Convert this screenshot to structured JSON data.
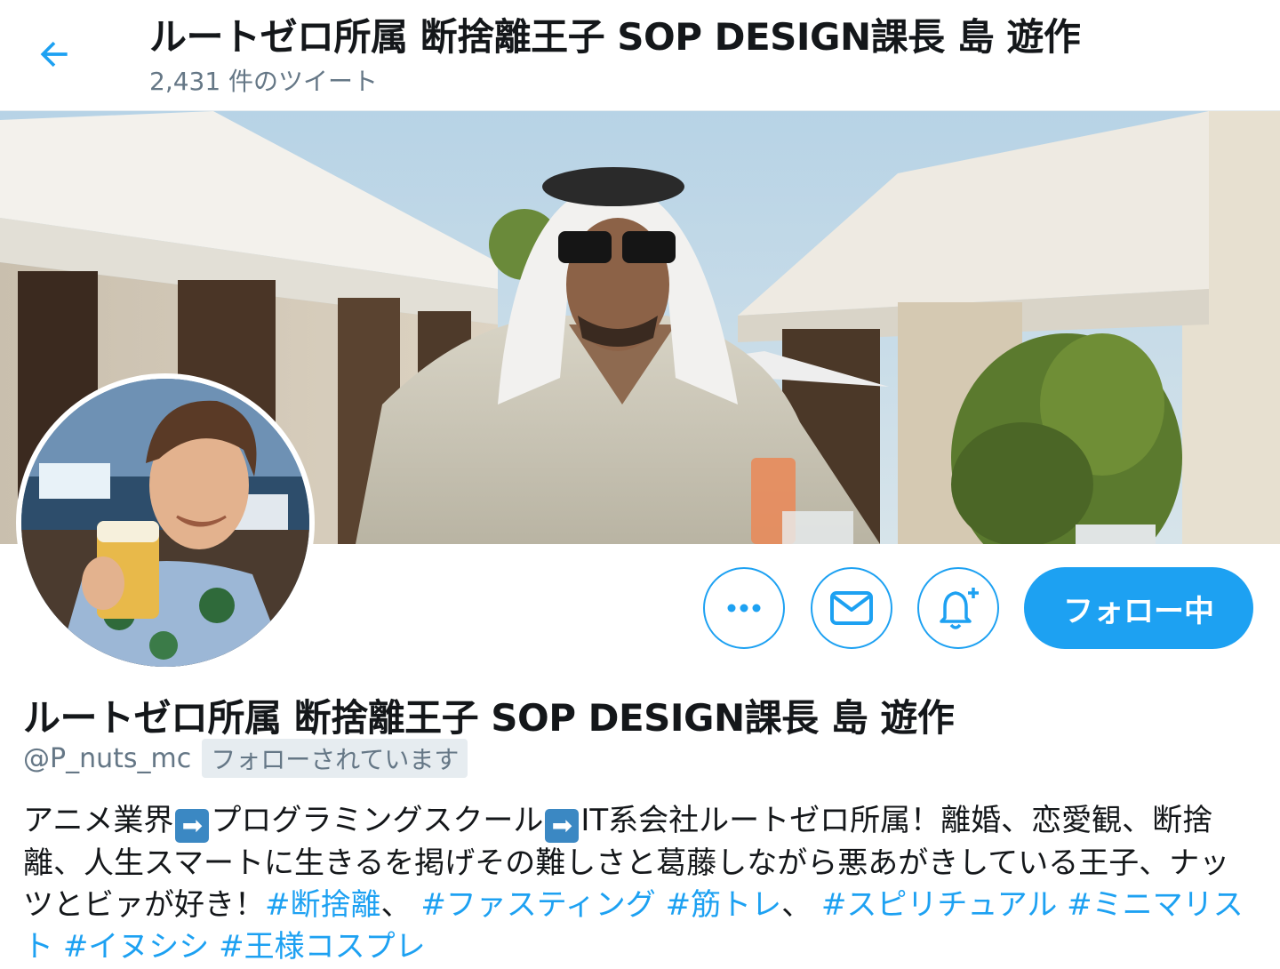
{
  "header": {
    "title": "ルートゼロ所属 断捨離王子 SOP DESIGN課長 島 遊作",
    "tweet_count": "2,431 件のツイート"
  },
  "actions": {
    "more_label": "•••",
    "follow_label": "フォロー中"
  },
  "profile": {
    "display_name": "ルートゼロ所属 断捨離王子 SOP DESIGN課長 島 遊作",
    "handle": "@P_nuts_mc",
    "follows_you": "フォローされています",
    "bio": {
      "part1": "アニメ業界",
      "arrow": "➡",
      "part2": "プログラミングスクール",
      "part3": "IT系会社ルートゼロ所属！離婚、恋愛観、断捨離、人生スマートに生きるを掲げその難しさと葛藤しながら悪あがきしている王子、ナッツとビァが好き！",
      "sep1": "、",
      "sep2": "、",
      "hashtags": [
        "#断捨離",
        "#ファスティング",
        "#筋トレ",
        "#スピリチュアル",
        "#ミニマリスト",
        "#イヌシシ",
        "#王様コスプレ"
      ]
    }
  },
  "colors": {
    "accent": "#1da1f2",
    "secondary_text": "#657786",
    "arrow_emoji_bg": "#3b88c3"
  },
  "icons": [
    "back-arrow-icon",
    "more-icon",
    "mail-icon",
    "bell-plus-icon"
  ]
}
